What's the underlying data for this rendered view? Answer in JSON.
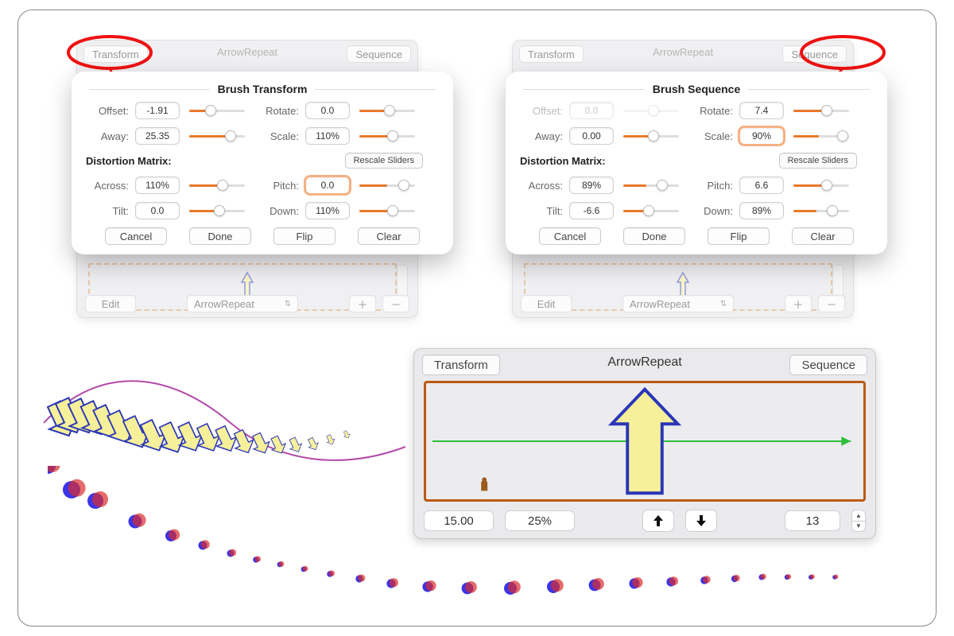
{
  "common": {
    "tab_transform": "Transform",
    "tab_sequence": "Sequence",
    "title_center": "ArrowRepeat",
    "edit": "Edit",
    "dropdown": "ArrowRepeat"
  },
  "section_title": "Distortion Matrix:",
  "rescale": "Rescale Sliders",
  "labels": {
    "offset": "Offset:",
    "rotate": "Rotate:",
    "away": "Away:",
    "scale": "Scale:",
    "across": "Across:",
    "pitch": "Pitch:",
    "tilt": "Tilt:",
    "down": "Down:"
  },
  "buttons": {
    "cancel": "Cancel",
    "done": "Done",
    "flip": "Flip",
    "clear": "Clear"
  },
  "transform_popup": {
    "title": "Brush Transform",
    "offset": "-1.91",
    "rotate": "0.0",
    "away": "25.35",
    "scale": "110%",
    "across": "110%",
    "pitch": "0.0",
    "tilt": "0.0",
    "down": "110%",
    "highlight": "pitch"
  },
  "sequence_popup": {
    "title": "Brush Sequence",
    "offset": "0.0",
    "rotate": "7.4",
    "away": "0.00",
    "scale": "90%",
    "across": "89%",
    "pitch": "6.6",
    "tilt": "-6.6",
    "down": "89%",
    "highlight": "scale",
    "offset_disabled": true
  },
  "big_panel": {
    "val_a": "15.00",
    "val_b": "25%",
    "count": "13"
  }
}
